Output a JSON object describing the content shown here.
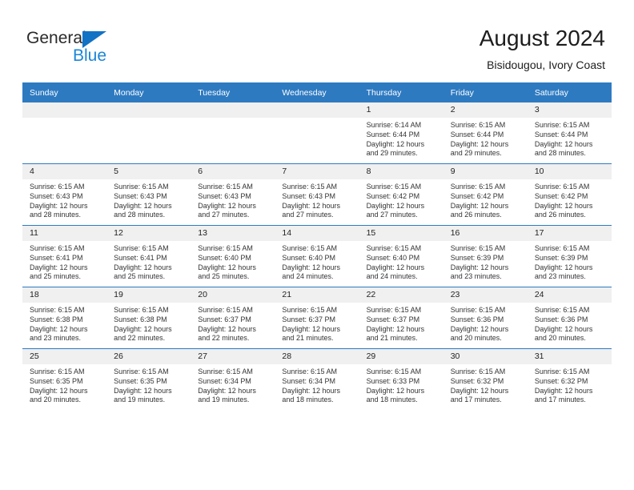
{
  "brand": {
    "name_part1": "General",
    "name_part2": "Blue",
    "logo_icon": "triangle-flag-icon",
    "accent_color": "#1272c4",
    "blue_text_color": "#1b86d8"
  },
  "header": {
    "title": "August 2024",
    "subtitle": "Bisidougou, Ivory Coast"
  },
  "theme": {
    "header_row_bg": "#2e7ac1",
    "day_number_bg": "#f0f0f0",
    "grid_line_color": "#2e7ac1",
    "text_color": "#333333"
  },
  "columns": [
    "Sunday",
    "Monday",
    "Tuesday",
    "Wednesday",
    "Thursday",
    "Friday",
    "Saturday"
  ],
  "weeks": [
    [
      {
        "day": "",
        "empty": true,
        "sunrise": "",
        "sunset": "",
        "daylight1": "",
        "daylight2": ""
      },
      {
        "day": "",
        "empty": true,
        "sunrise": "",
        "sunset": "",
        "daylight1": "",
        "daylight2": ""
      },
      {
        "day": "",
        "empty": true,
        "sunrise": "",
        "sunset": "",
        "daylight1": "",
        "daylight2": ""
      },
      {
        "day": "",
        "empty": true,
        "sunrise": "",
        "sunset": "",
        "daylight1": "",
        "daylight2": ""
      },
      {
        "day": "1",
        "empty": false,
        "sunrise": "Sunrise: 6:14 AM",
        "sunset": "Sunset: 6:44 PM",
        "daylight1": "Daylight: 12 hours",
        "daylight2": "and 29 minutes."
      },
      {
        "day": "2",
        "empty": false,
        "sunrise": "Sunrise: 6:15 AM",
        "sunset": "Sunset: 6:44 PM",
        "daylight1": "Daylight: 12 hours",
        "daylight2": "and 29 minutes."
      },
      {
        "day": "3",
        "empty": false,
        "sunrise": "Sunrise: 6:15 AM",
        "sunset": "Sunset: 6:44 PM",
        "daylight1": "Daylight: 12 hours",
        "daylight2": "and 28 minutes."
      }
    ],
    [
      {
        "day": "4",
        "empty": false,
        "sunrise": "Sunrise: 6:15 AM",
        "sunset": "Sunset: 6:43 PM",
        "daylight1": "Daylight: 12 hours",
        "daylight2": "and 28 minutes."
      },
      {
        "day": "5",
        "empty": false,
        "sunrise": "Sunrise: 6:15 AM",
        "sunset": "Sunset: 6:43 PM",
        "daylight1": "Daylight: 12 hours",
        "daylight2": "and 28 minutes."
      },
      {
        "day": "6",
        "empty": false,
        "sunrise": "Sunrise: 6:15 AM",
        "sunset": "Sunset: 6:43 PM",
        "daylight1": "Daylight: 12 hours",
        "daylight2": "and 27 minutes."
      },
      {
        "day": "7",
        "empty": false,
        "sunrise": "Sunrise: 6:15 AM",
        "sunset": "Sunset: 6:43 PM",
        "daylight1": "Daylight: 12 hours",
        "daylight2": "and 27 minutes."
      },
      {
        "day": "8",
        "empty": false,
        "sunrise": "Sunrise: 6:15 AM",
        "sunset": "Sunset: 6:42 PM",
        "daylight1": "Daylight: 12 hours",
        "daylight2": "and 27 minutes."
      },
      {
        "day": "9",
        "empty": false,
        "sunrise": "Sunrise: 6:15 AM",
        "sunset": "Sunset: 6:42 PM",
        "daylight1": "Daylight: 12 hours",
        "daylight2": "and 26 minutes."
      },
      {
        "day": "10",
        "empty": false,
        "sunrise": "Sunrise: 6:15 AM",
        "sunset": "Sunset: 6:42 PM",
        "daylight1": "Daylight: 12 hours",
        "daylight2": "and 26 minutes."
      }
    ],
    [
      {
        "day": "11",
        "empty": false,
        "sunrise": "Sunrise: 6:15 AM",
        "sunset": "Sunset: 6:41 PM",
        "daylight1": "Daylight: 12 hours",
        "daylight2": "and 25 minutes."
      },
      {
        "day": "12",
        "empty": false,
        "sunrise": "Sunrise: 6:15 AM",
        "sunset": "Sunset: 6:41 PM",
        "daylight1": "Daylight: 12 hours",
        "daylight2": "and 25 minutes."
      },
      {
        "day": "13",
        "empty": false,
        "sunrise": "Sunrise: 6:15 AM",
        "sunset": "Sunset: 6:40 PM",
        "daylight1": "Daylight: 12 hours",
        "daylight2": "and 25 minutes."
      },
      {
        "day": "14",
        "empty": false,
        "sunrise": "Sunrise: 6:15 AM",
        "sunset": "Sunset: 6:40 PM",
        "daylight1": "Daylight: 12 hours",
        "daylight2": "and 24 minutes."
      },
      {
        "day": "15",
        "empty": false,
        "sunrise": "Sunrise: 6:15 AM",
        "sunset": "Sunset: 6:40 PM",
        "daylight1": "Daylight: 12 hours",
        "daylight2": "and 24 minutes."
      },
      {
        "day": "16",
        "empty": false,
        "sunrise": "Sunrise: 6:15 AM",
        "sunset": "Sunset: 6:39 PM",
        "daylight1": "Daylight: 12 hours",
        "daylight2": "and 23 minutes."
      },
      {
        "day": "17",
        "empty": false,
        "sunrise": "Sunrise: 6:15 AM",
        "sunset": "Sunset: 6:39 PM",
        "daylight1": "Daylight: 12 hours",
        "daylight2": "and 23 minutes."
      }
    ],
    [
      {
        "day": "18",
        "empty": false,
        "sunrise": "Sunrise: 6:15 AM",
        "sunset": "Sunset: 6:38 PM",
        "daylight1": "Daylight: 12 hours",
        "daylight2": "and 23 minutes."
      },
      {
        "day": "19",
        "empty": false,
        "sunrise": "Sunrise: 6:15 AM",
        "sunset": "Sunset: 6:38 PM",
        "daylight1": "Daylight: 12 hours",
        "daylight2": "and 22 minutes."
      },
      {
        "day": "20",
        "empty": false,
        "sunrise": "Sunrise: 6:15 AM",
        "sunset": "Sunset: 6:37 PM",
        "daylight1": "Daylight: 12 hours",
        "daylight2": "and 22 minutes."
      },
      {
        "day": "21",
        "empty": false,
        "sunrise": "Sunrise: 6:15 AM",
        "sunset": "Sunset: 6:37 PM",
        "daylight1": "Daylight: 12 hours",
        "daylight2": "and 21 minutes."
      },
      {
        "day": "22",
        "empty": false,
        "sunrise": "Sunrise: 6:15 AM",
        "sunset": "Sunset: 6:37 PM",
        "daylight1": "Daylight: 12 hours",
        "daylight2": "and 21 minutes."
      },
      {
        "day": "23",
        "empty": false,
        "sunrise": "Sunrise: 6:15 AM",
        "sunset": "Sunset: 6:36 PM",
        "daylight1": "Daylight: 12 hours",
        "daylight2": "and 20 minutes."
      },
      {
        "day": "24",
        "empty": false,
        "sunrise": "Sunrise: 6:15 AM",
        "sunset": "Sunset: 6:36 PM",
        "daylight1": "Daylight: 12 hours",
        "daylight2": "and 20 minutes."
      }
    ],
    [
      {
        "day": "25",
        "empty": false,
        "sunrise": "Sunrise: 6:15 AM",
        "sunset": "Sunset: 6:35 PM",
        "daylight1": "Daylight: 12 hours",
        "daylight2": "and 20 minutes."
      },
      {
        "day": "26",
        "empty": false,
        "sunrise": "Sunrise: 6:15 AM",
        "sunset": "Sunset: 6:35 PM",
        "daylight1": "Daylight: 12 hours",
        "daylight2": "and 19 minutes."
      },
      {
        "day": "27",
        "empty": false,
        "sunrise": "Sunrise: 6:15 AM",
        "sunset": "Sunset: 6:34 PM",
        "daylight1": "Daylight: 12 hours",
        "daylight2": "and 19 minutes."
      },
      {
        "day": "28",
        "empty": false,
        "sunrise": "Sunrise: 6:15 AM",
        "sunset": "Sunset: 6:34 PM",
        "daylight1": "Daylight: 12 hours",
        "daylight2": "and 18 minutes."
      },
      {
        "day": "29",
        "empty": false,
        "sunrise": "Sunrise: 6:15 AM",
        "sunset": "Sunset: 6:33 PM",
        "daylight1": "Daylight: 12 hours",
        "daylight2": "and 18 minutes."
      },
      {
        "day": "30",
        "empty": false,
        "sunrise": "Sunrise: 6:15 AM",
        "sunset": "Sunset: 6:32 PM",
        "daylight1": "Daylight: 12 hours",
        "daylight2": "and 17 minutes."
      },
      {
        "day": "31",
        "empty": false,
        "sunrise": "Sunrise: 6:15 AM",
        "sunset": "Sunset: 6:32 PM",
        "daylight1": "Daylight: 12 hours",
        "daylight2": "and 17 minutes."
      }
    ]
  ]
}
